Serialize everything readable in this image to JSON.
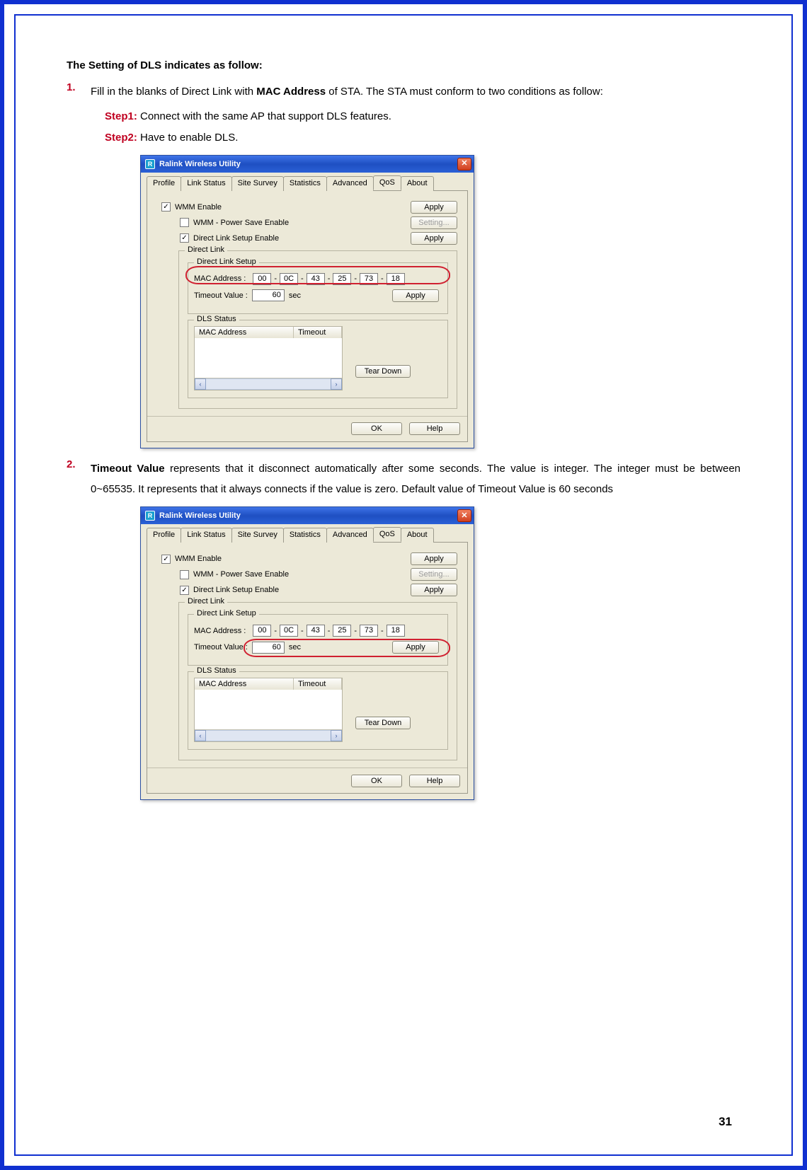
{
  "page": {
    "number": "31"
  },
  "text": {
    "heading": "The Setting of DLS indicates as follow:",
    "li1_num": "1.",
    "li1_a": "Fill in the blanks of Direct Link with ",
    "li1_mac": "MAC Address",
    "li1_b": " of STA. The STA must conform to two conditions as follow:",
    "step1_label": "Step1:",
    "step1_text": " Connect with the same AP that support DLS features.",
    "step2_label": "Step2:",
    "step2_text": " Have to enable DLS.",
    "li2_num": "2.",
    "li2_bold": "Timeout Value",
    "li2_rest": " represents that it disconnect automatically after some seconds. The value is integer. The integer must be between 0~65535. It represents that it always connects if the value is zero. Default value of Timeout Value is 60 seconds"
  },
  "window": {
    "title": "Ralink Wireless Utility",
    "icon_glyph": "R",
    "close_glyph": "✕",
    "tabs": {
      "profile": "Profile",
      "link_status": "Link Status",
      "site_survey": "Site Survey",
      "statistics": "Statistics",
      "advanced": "Advanced",
      "qos": "QoS",
      "about": "About"
    },
    "checks": {
      "wmm_enable": "WMM Enable",
      "wmm_ps": "WMM - Power Save Enable",
      "dls_enable": "Direct Link Setup Enable",
      "glyph_checked": "✓"
    },
    "buttons": {
      "apply": "Apply",
      "setting": "Setting...",
      "tear_down": "Tear Down",
      "ok": "OK",
      "help": "Help"
    },
    "groups": {
      "direct_link": "Direct Link",
      "direct_link_setup": "Direct Link Setup",
      "dls_status": "DLS Status"
    },
    "labels": {
      "mac_address": "MAC Address :",
      "timeout_value": "Timeout Value :",
      "sec": "sec",
      "dash": "-"
    },
    "mac": {
      "o1": "00",
      "o2": "0C",
      "o3": "43",
      "o4": "25",
      "o5": "73",
      "o6": "18"
    },
    "timeout": "60",
    "table": {
      "col_mac": "MAC Address",
      "col_timeout": "Timeout"
    },
    "scroll": {
      "left": "‹",
      "right": "›"
    }
  }
}
